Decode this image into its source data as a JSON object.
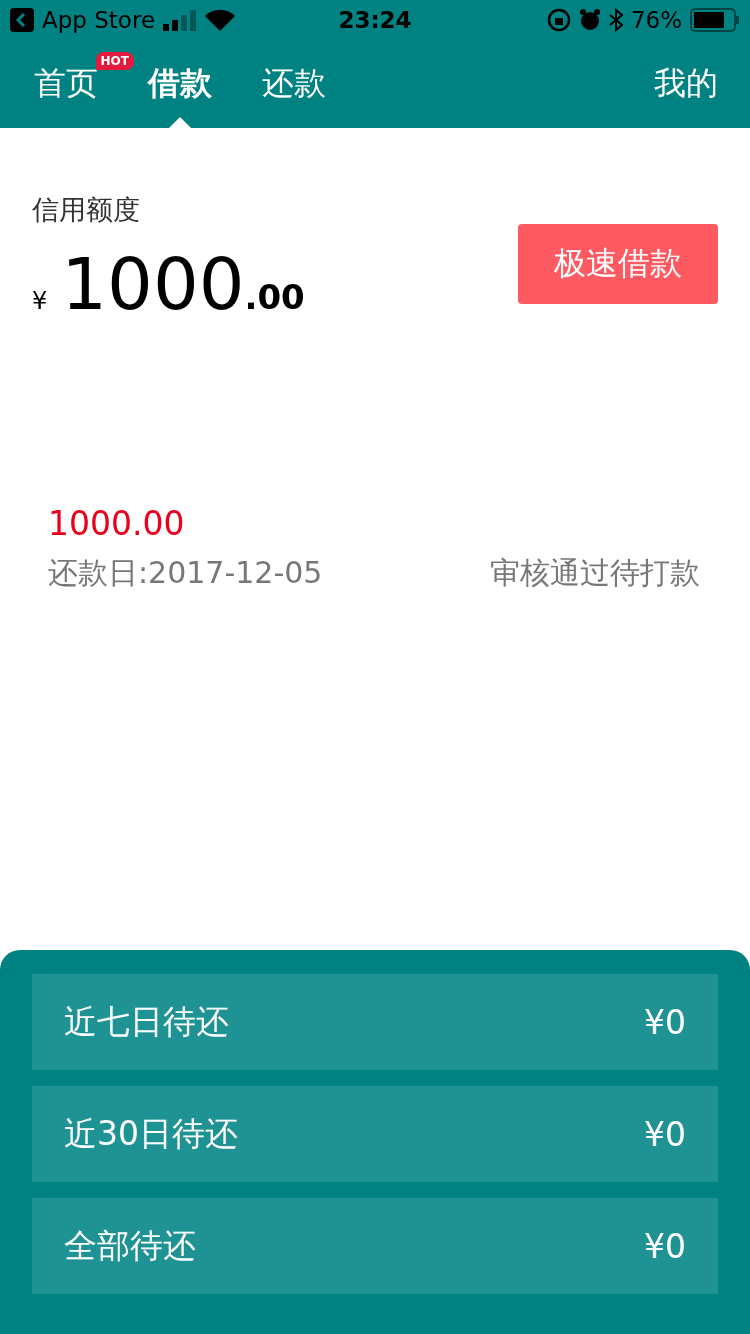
{
  "status_bar": {
    "back_label": "App Store",
    "time": "23:24",
    "battery": "76%"
  },
  "tabs": [
    {
      "label": "首页",
      "selected": false,
      "badge": "HOT"
    },
    {
      "label": "借款",
      "selected": true
    },
    {
      "label": "还款",
      "selected": false
    }
  ],
  "profile_tab": {
    "label": "我的",
    "selected": false
  },
  "credit": {
    "label": "信用额度",
    "currency": "¥",
    "integer": "1000",
    "decimal": ".00",
    "button": "极速借款"
  },
  "loan": {
    "amount": "1000.00",
    "due_date": "还款日:2017-12-05",
    "status": "审核通过待打款"
  },
  "summary": [
    {
      "label": "近七日待还",
      "value": "¥0"
    },
    {
      "label": "近30日待还",
      "value": "¥0"
    },
    {
      "label": "全部待还",
      "value": "¥0"
    }
  ]
}
